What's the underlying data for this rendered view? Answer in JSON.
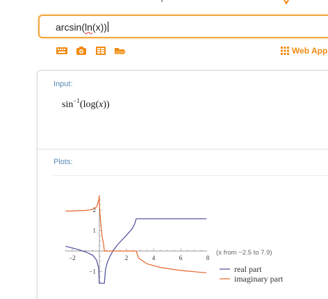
{
  "search": {
    "query_prefix": "arcsin(",
    "query_ln": "ln",
    "query_suffix": "(x))"
  },
  "toolbar": {
    "icons": [
      "keyboard-icon",
      "camera-icon",
      "table-icon",
      "folder-icon"
    ],
    "web_apps_label": "Web Apps"
  },
  "pods": {
    "input": {
      "title": "Input:",
      "formula_func": "sin",
      "formula_exp": "−1",
      "formula_open": "(log(",
      "formula_var": "x",
      "formula_close": "))"
    },
    "plots": {
      "title": "Plots:",
      "range_note": "(x from −2.5 to 7.9)",
      "legend": [
        {
          "label": "real part",
          "color": "#4a4a9c"
        },
        {
          "label": "imaginary part",
          "color": "#e5642a"
        }
      ]
    }
  },
  "chart_data": {
    "type": "line",
    "title": "",
    "xlabel": "",
    "ylabel": "",
    "xlim": [
      -2.5,
      7.9
    ],
    "ylim": [
      -1.6,
      2.7
    ],
    "x_ticks": [
      -2,
      2,
      4,
      6,
      8
    ],
    "y_ticks": [
      -1,
      1,
      2
    ],
    "x_tick_labels": [
      "−2",
      "2",
      "4",
      "6",
      "8"
    ],
    "y_tick_labels": [
      "−1",
      "1",
      "2"
    ],
    "series": [
      {
        "name": "real part",
        "color": "#4a4a9c",
        "points": [
          [
            -2.5,
            0.23
          ],
          [
            -2.0,
            0.15
          ],
          [
            -1.5,
            0.06
          ],
          [
            -1.0,
            -0.05
          ],
          [
            -0.5,
            -0.2
          ],
          [
            -0.2,
            -0.45
          ],
          [
            -0.05,
            -0.85
          ],
          [
            -0.01,
            -1.57
          ],
          [
            0.05,
            -1.57
          ],
          [
            0.25,
            -1.57
          ],
          [
            0.37,
            -1.57
          ],
          [
            0.45,
            -0.9
          ],
          [
            0.6,
            -0.53
          ],
          [
            0.8,
            -0.23
          ],
          [
            1.0,
            0.0
          ],
          [
            1.3,
            0.27
          ],
          [
            1.6,
            0.49
          ],
          [
            2.0,
            0.77
          ],
          [
            2.4,
            1.07
          ],
          [
            2.6,
            1.31
          ],
          [
            2.718,
            1.571
          ],
          [
            7.9,
            1.571
          ]
        ]
      },
      {
        "name": "imaginary part",
        "color": "#e5642a",
        "points": [
          [
            -2.5,
            1.95
          ],
          [
            -2.0,
            1.95
          ],
          [
            -1.5,
            1.97
          ],
          [
            -1.0,
            1.98
          ],
          [
            -0.5,
            2.03
          ],
          [
            -0.2,
            2.15
          ],
          [
            -0.05,
            2.45
          ],
          [
            -0.01,
            2.7
          ],
          [
            0.02,
            2.0
          ],
          [
            0.1,
            1.4
          ],
          [
            0.2,
            0.7
          ],
          [
            0.3,
            0.4
          ],
          [
            0.37,
            0.0
          ],
          [
            1.0,
            0.0
          ],
          [
            2.718,
            0.0
          ],
          [
            2.9,
            -0.35
          ],
          [
            3.5,
            -0.62
          ],
          [
            4.5,
            -0.8
          ],
          [
            6.0,
            -0.95
          ],
          [
            7.9,
            -1.06
          ]
        ]
      }
    ],
    "grid": false,
    "legend_position": "bottom-right"
  }
}
